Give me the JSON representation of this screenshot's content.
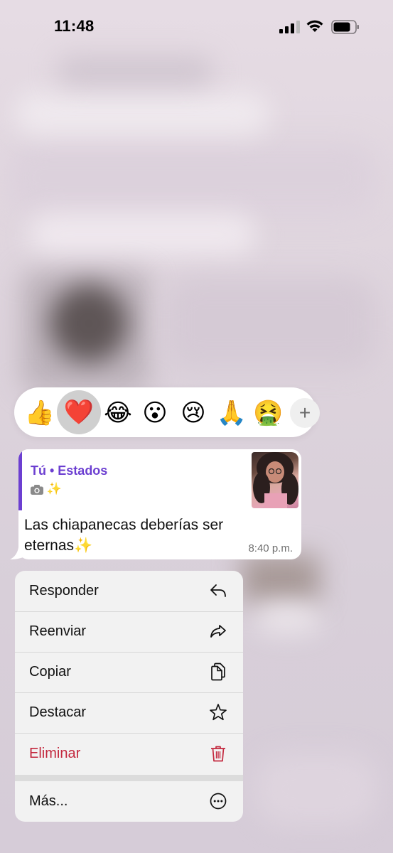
{
  "status_bar": {
    "time": "11:48"
  },
  "reactions": {
    "emojis": [
      {
        "glyph": "👍",
        "name": "thumbs-up"
      },
      {
        "glyph": "❤️",
        "name": "heart",
        "selected": true
      },
      {
        "glyph": "😂",
        "name": "tears-of-joy"
      },
      {
        "glyph": "😮",
        "name": "surprised"
      },
      {
        "glyph": "😢",
        "name": "crying"
      },
      {
        "glyph": "🙏",
        "name": "folded-hands"
      },
      {
        "glyph": "🤮",
        "name": "vomiting"
      }
    ],
    "more": "+"
  },
  "message": {
    "quote_title": "Tú • Estados",
    "quote_sub": "✨",
    "text": "Las chiapanecas deberías ser eternas✨",
    "time": "8:40 p.m."
  },
  "menu": {
    "items": [
      {
        "label": "Responder",
        "icon": "reply-icon"
      },
      {
        "label": "Reenviar",
        "icon": "forward-icon"
      },
      {
        "label": "Copiar",
        "icon": "copy-icon"
      },
      {
        "label": "Destacar",
        "icon": "star-icon"
      },
      {
        "label": "Eliminar",
        "icon": "trash-icon",
        "color": "#c3283e"
      },
      {
        "label": "Más...",
        "icon": "more-icon"
      }
    ]
  }
}
